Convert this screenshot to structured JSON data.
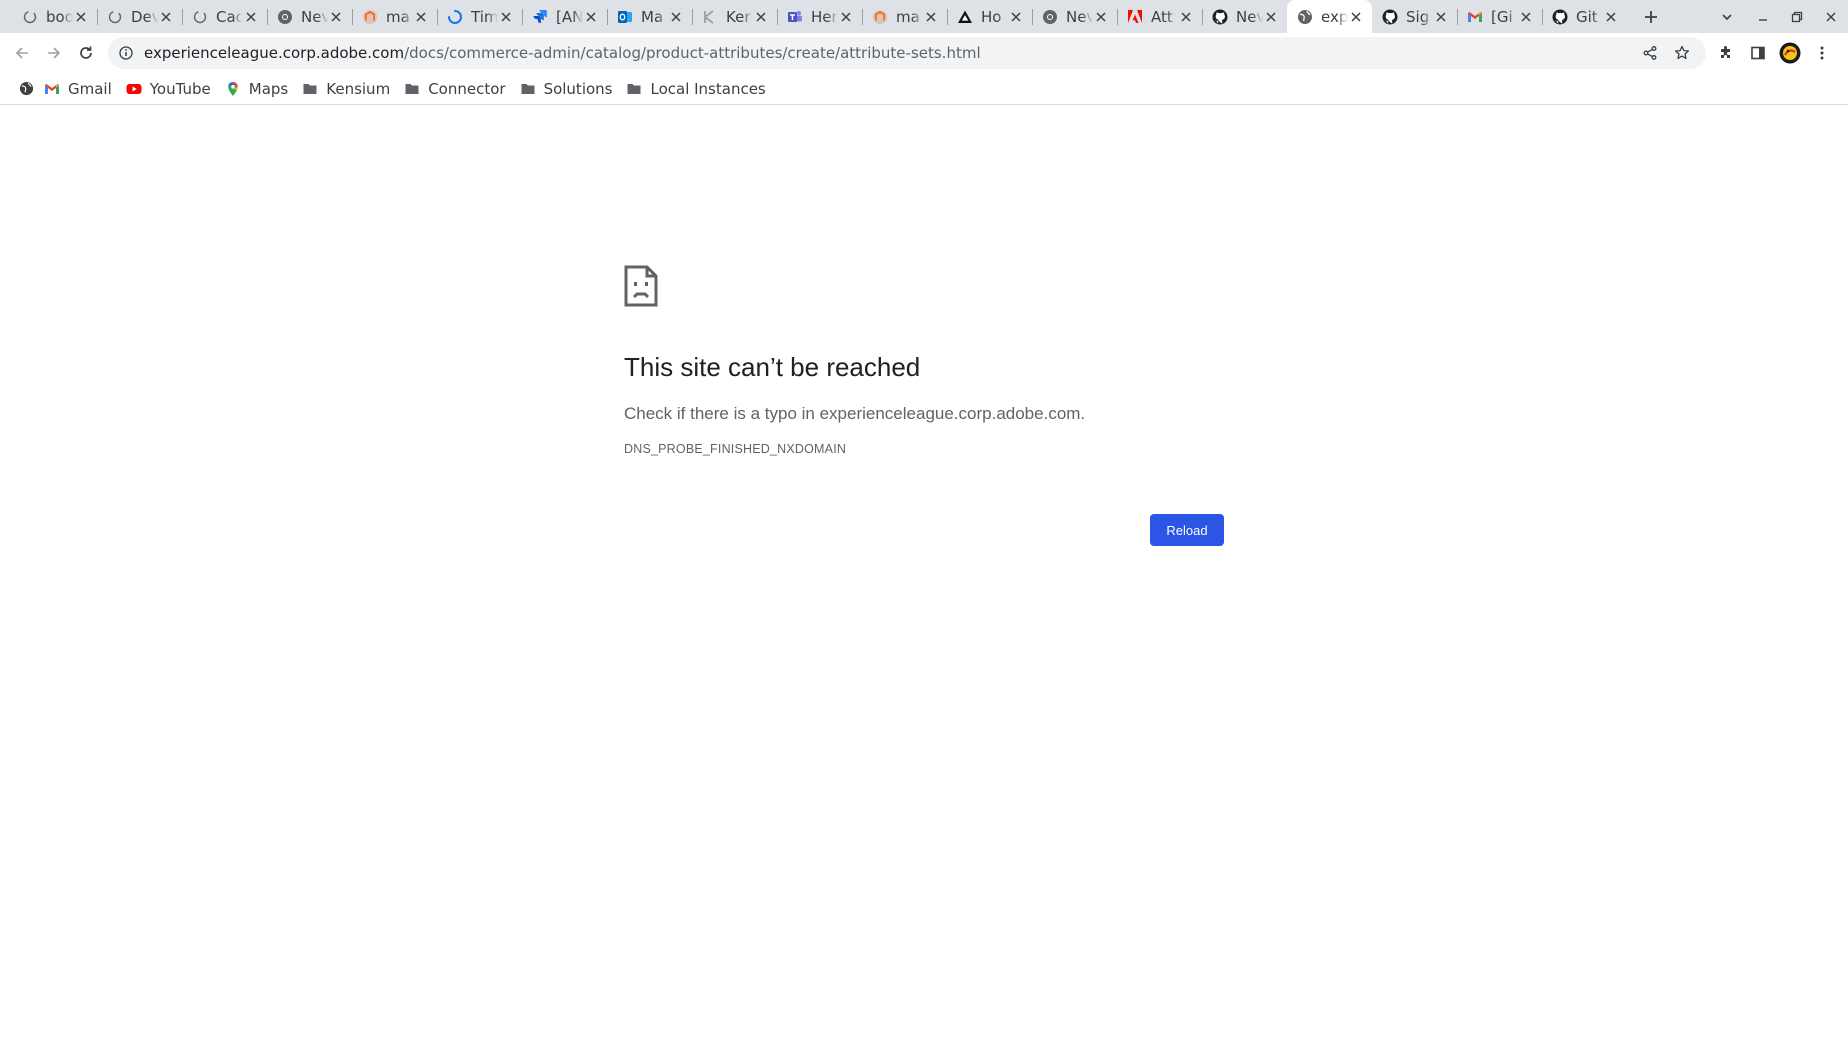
{
  "browser": {
    "tabs": [
      {
        "title": "boo",
        "favicon": "blank-circle-icon",
        "active": false
      },
      {
        "title": "Dev",
        "favicon": "blank-circle-icon",
        "active": false
      },
      {
        "title": "Cac",
        "favicon": "blank-circle-icon",
        "active": false
      },
      {
        "title": "Nev",
        "favicon": "chrome-icon",
        "active": false
      },
      {
        "title": "ma",
        "favicon": "magento-icon",
        "active": false
      },
      {
        "title": "Tim",
        "favicon": "loading-spinner-icon",
        "active": false
      },
      {
        "title": "[AN",
        "favicon": "jira-icon",
        "active": false
      },
      {
        "title": "Ma",
        "favicon": "outlook-icon",
        "active": false
      },
      {
        "title": "Ker",
        "favicon": "kensium-icon",
        "active": false
      },
      {
        "title": "Her",
        "favicon": "teams-icon",
        "active": false
      },
      {
        "title": "ma",
        "favicon": "magento-icon",
        "active": false
      },
      {
        "title": "Ho",
        "favicon": "triangle-icon",
        "active": false
      },
      {
        "title": "Nev",
        "favicon": "chrome-icon",
        "active": false
      },
      {
        "title": "Att",
        "favicon": "adobe-icon",
        "active": false
      },
      {
        "title": "Nev",
        "favicon": "github-icon",
        "active": false
      },
      {
        "title": "exp",
        "favicon": "globe-icon",
        "active": true
      },
      {
        "title": "Sig",
        "favicon": "github-icon",
        "active": false
      },
      {
        "title": "[Gi",
        "favicon": "gmail-icon",
        "active": false
      },
      {
        "title": "Git",
        "favicon": "github-icon",
        "active": false
      }
    ],
    "url": {
      "domain": "experienceleague.corp.adobe.com",
      "path": "/docs/commerce-admin/catalog/product-attributes/create/attribute-sets.html"
    },
    "bookmarks": [
      {
        "label": "Gmail",
        "icon": "gmail-icon"
      },
      {
        "label": "YouTube",
        "icon": "youtube-icon"
      },
      {
        "label": "Maps",
        "icon": "maps-icon"
      },
      {
        "label": "Kensium",
        "icon": "folder-icon"
      },
      {
        "label": "Connector",
        "icon": "folder-icon"
      },
      {
        "label": "Solutions",
        "icon": "folder-icon"
      },
      {
        "label": "Local Instances",
        "icon": "folder-icon"
      }
    ]
  },
  "error_page": {
    "title": "This site can’t be reached",
    "message": "Check if there is a typo in experienceleague.corp.adobe.com.",
    "code": "DNS_PROBE_FINISHED_NXDOMAIN",
    "reload_label": "Reload"
  },
  "colors": {
    "tabstrip_bg": "#dee1e6",
    "omnibox_bg": "#f1f3f4",
    "reload_button": "#2a55e5",
    "title_text": "#202124",
    "secondary_text": "#5f6368"
  }
}
